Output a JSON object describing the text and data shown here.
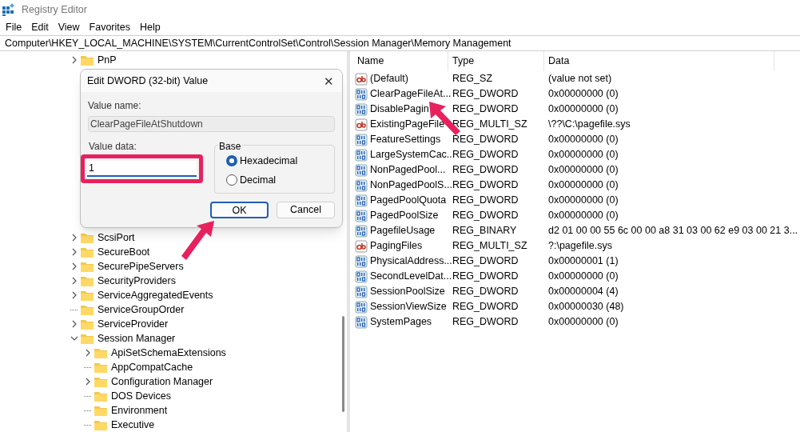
{
  "window": {
    "title": "Registry Editor"
  },
  "menu": [
    "File",
    "Edit",
    "View",
    "Favorites",
    "Help"
  ],
  "address": "Computer\\HKEY_LOCAL_MACHINE\\SYSTEM\\CurrentControlSet\\Control\\Session Manager\\Memory Management",
  "tree": {
    "top": [
      {
        "label": "PnP",
        "kind": "branch",
        "expanded": false
      }
    ],
    "items": [
      {
        "label": "ScsiPort",
        "kind": "branch",
        "expanded": false
      },
      {
        "label": "SecureBoot",
        "kind": "branch",
        "expanded": false
      },
      {
        "label": "SecurePipeServers",
        "kind": "branch",
        "expanded": false
      },
      {
        "label": "SecurityProviders",
        "kind": "branch",
        "expanded": false
      },
      {
        "label": "ServiceAggregatedEvents",
        "kind": "branch",
        "expanded": false
      },
      {
        "label": "ServiceGroupOrder",
        "kind": "leaf"
      },
      {
        "label": "ServiceProvider",
        "kind": "branch",
        "expanded": false
      },
      {
        "label": "Session Manager",
        "kind": "branch",
        "expanded": true,
        "children": [
          {
            "label": "ApiSetSchemaExtensions",
            "kind": "branch",
            "expanded": false
          },
          {
            "label": "AppCompatCache",
            "kind": "leaf"
          },
          {
            "label": "Configuration Manager",
            "kind": "branch",
            "expanded": false
          },
          {
            "label": "DOS Devices",
            "kind": "leaf"
          },
          {
            "label": "Environment",
            "kind": "leaf"
          },
          {
            "label": "Executive",
            "kind": "leaf"
          }
        ]
      }
    ]
  },
  "values": {
    "columns": [
      "Name",
      "Type",
      "Data"
    ],
    "rows": [
      {
        "name": "(Default)",
        "type": "REG_SZ",
        "data": "(value not set)",
        "kind": "string"
      },
      {
        "name": "ClearPageFileAt...",
        "type": "REG_DWORD",
        "data": "0x00000000 (0)",
        "kind": "binary"
      },
      {
        "name": "DisablePagin",
        "type": "REG_DWORD",
        "data": "0x00000000 (0)",
        "kind": "binary"
      },
      {
        "name": "ExistingPageFile",
        "type": "REG_MULTI_SZ",
        "data": "\\??\\C:\\pagefile.sys",
        "kind": "string"
      },
      {
        "name": "FeatureSettings",
        "type": "REG_DWORD",
        "data": "0x00000000 (0)",
        "kind": "binary"
      },
      {
        "name": "LargeSystemCac...",
        "type": "REG_DWORD",
        "data": "0x00000000 (0)",
        "kind": "binary"
      },
      {
        "name": "NonPagedPool...",
        "type": "REG_DWORD",
        "data": "0x00000000 (0)",
        "kind": "binary"
      },
      {
        "name": "NonPagedPoolS...",
        "type": "REG_DWORD",
        "data": "0x00000000 (0)",
        "kind": "binary"
      },
      {
        "name": "PagedPoolQuota",
        "type": "REG_DWORD",
        "data": "0x00000000 (0)",
        "kind": "binary"
      },
      {
        "name": "PagedPoolSize",
        "type": "REG_DWORD",
        "data": "0x00000000 (0)",
        "kind": "binary"
      },
      {
        "name": "PagefileUsage",
        "type": "REG_BINARY",
        "data": "d2 01 00 00 55 6c 00 00 a8 31 03 00 62 e9 03 00 21 3...",
        "kind": "binary"
      },
      {
        "name": "PagingFiles",
        "type": "REG_MULTI_SZ",
        "data": "?:\\pagefile.sys",
        "kind": "string"
      },
      {
        "name": "PhysicalAddress...",
        "type": "REG_DWORD",
        "data": "0x00000001 (1)",
        "kind": "binary"
      },
      {
        "name": "SecondLevelDat...",
        "type": "REG_DWORD",
        "data": "0x00000000 (0)",
        "kind": "binary"
      },
      {
        "name": "SessionPoolSize",
        "type": "REG_DWORD",
        "data": "0x00000004 (4)",
        "kind": "binary"
      },
      {
        "name": "SessionViewSize",
        "type": "REG_DWORD",
        "data": "0x00000030 (48)",
        "kind": "binary"
      },
      {
        "name": "SystemPages",
        "type": "REG_DWORD",
        "data": "0x00000000 (0)",
        "kind": "binary"
      }
    ]
  },
  "dialog": {
    "title": "Edit DWORD (32-bit) Value",
    "close": "✕",
    "value_name_label": "Value name:",
    "value_name": "ClearPageFileAtShutdown",
    "value_data_label": "Value data:",
    "value_data": "1",
    "base_label": "Base",
    "radios": [
      {
        "label": "Hexadecimal",
        "selected": true
      },
      {
        "label": "Decimal",
        "selected": false
      }
    ],
    "buttons": [
      {
        "label": "OK",
        "focused": true
      },
      {
        "label": "Cancel",
        "focused": false
      }
    ]
  }
}
